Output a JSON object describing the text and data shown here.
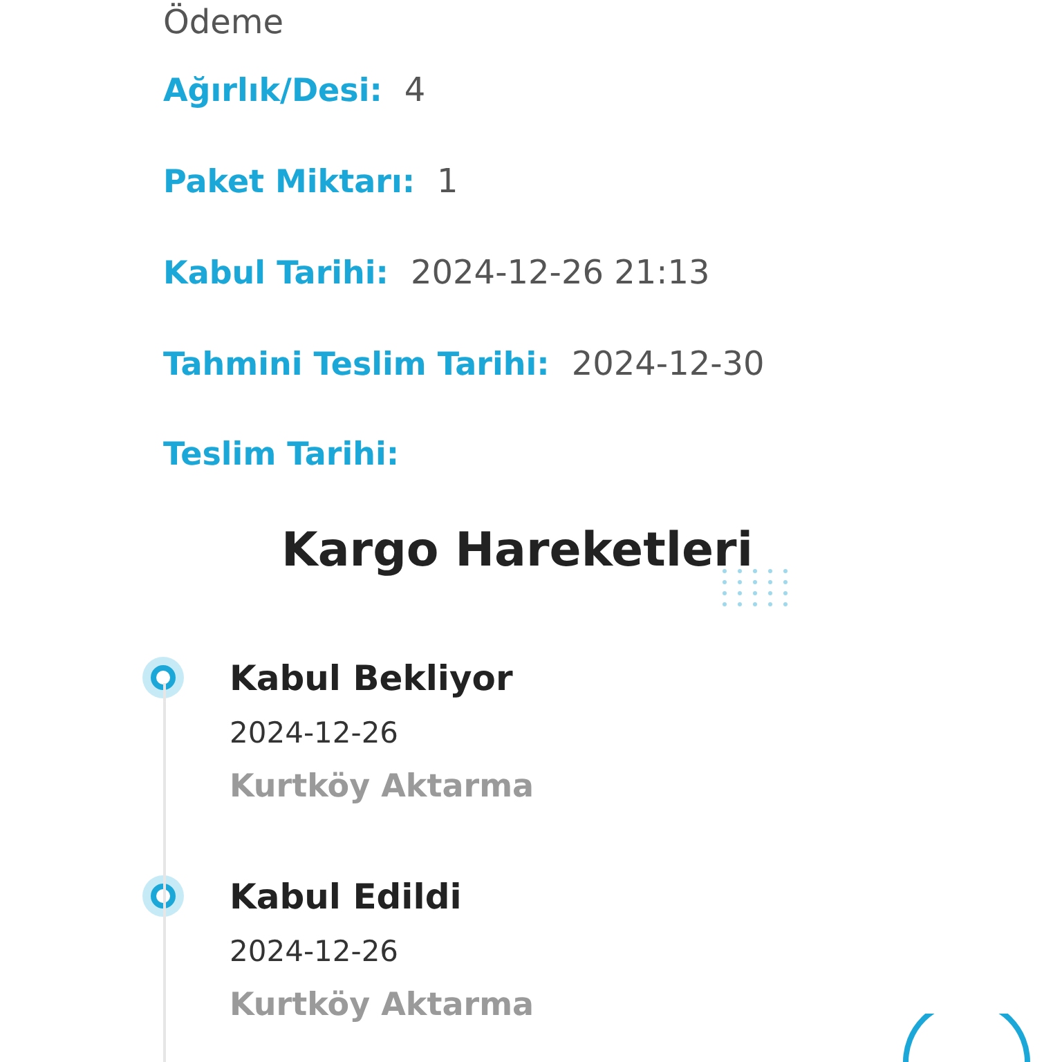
{
  "top_text": "Ödeme",
  "details": [
    {
      "label": "Ağırlık/Desi:",
      "value": "4"
    },
    {
      "label": "Paket Miktarı:",
      "value": "1"
    },
    {
      "label": "Kabul Tarihi:",
      "value": "2024-12-26 21:13"
    },
    {
      "label": "Tahmini Teslim Tarihi:",
      "value": "2024-12-30"
    },
    {
      "label": "Teslim Tarihi:"
    }
  ],
  "section_title": "Kargo Hareketleri",
  "events": [
    {
      "title": "Kabul Bekliyor",
      "date": "2024-12-26",
      "location": "Kurtköy Aktarma"
    },
    {
      "title": "Kabul Edildi",
      "date": "2024-12-26",
      "location": "Kurtköy Aktarma"
    }
  ]
}
